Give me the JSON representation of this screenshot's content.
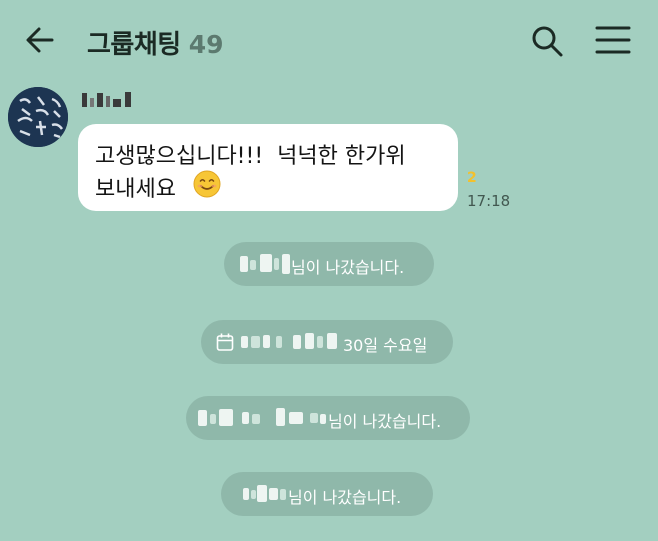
{
  "header": {
    "title": "그룹채팅",
    "member_count": "49",
    "icons": {
      "back": "arrow-left-icon",
      "search": "search-icon",
      "menu": "hamburger-menu-icon"
    }
  },
  "message": {
    "line1": "고생많으십니다!!!  넉넉한 한가위",
    "line2": "보내세요",
    "emoji": "smiling-face-emoji",
    "unread_count": "2",
    "time": "17:18"
  },
  "notices": [
    {
      "suffix": "님이 나갔습니다."
    },
    {
      "suffix": "30일 수요일",
      "icon": "calendar-icon"
    },
    {
      "suffix": "님이 나갔습니다."
    },
    {
      "suffix": "님이 나갔습니다."
    }
  ],
  "colors": {
    "background": "#a3cfc0",
    "notice_pill": "#8fb8aa",
    "bubble": "#ffffff",
    "unread_badge": "#f3c12d"
  }
}
